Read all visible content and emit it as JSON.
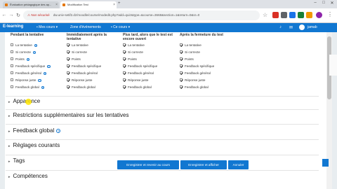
{
  "browser": {
    "tabs": [
      {
        "label": "Évaluation pédagogique des ap...",
        "active": false
      },
      {
        "label": "Modification Test",
        "active": true
      }
    ],
    "address": {
      "warning": "Non sécurisé",
      "url": "dw.univ-setif2.dz/moodle/course/modedit.php?add=quiz&type=&course=3668&section=1&return=0&sr=0"
    }
  },
  "navbar": {
    "brand": "E-learning",
    "items": [
      "Mes cours",
      "Zone d'événements",
      "Ce cours"
    ],
    "user": "jamab"
  },
  "review": {
    "columns": [
      {
        "title": "Pendant la tentative",
        "options": [
          {
            "label": "La tentative",
            "checked": false,
            "help": true
          },
          {
            "label": "Si correcte",
            "checked": false,
            "help": true
          },
          {
            "label": "Points",
            "checked": false,
            "help": true
          },
          {
            "label": "Feedback spécifique",
            "checked": false,
            "help": true
          },
          {
            "label": "Feedback général",
            "checked": false,
            "help": true
          },
          {
            "label": "Réponse juste",
            "checked": false,
            "help": true
          },
          {
            "label": "Feedback global",
            "checked": false,
            "help": true
          }
        ]
      },
      {
        "title": "Immédiatement après la tentative",
        "options": [
          {
            "label": "La tentative",
            "checked": true
          },
          {
            "label": "Si correcte",
            "checked": true
          },
          {
            "label": "Points",
            "checked": true
          },
          {
            "label": "Feedback spécifique",
            "checked": true
          },
          {
            "label": "Feedback général",
            "checked": true
          },
          {
            "label": "Réponse juste",
            "checked": true
          },
          {
            "label": "Feedback global",
            "checked": true
          }
        ]
      },
      {
        "title": "Plus tard, alors que le test est encore ouvert",
        "options": [
          {
            "label": "La tentative",
            "checked": true
          },
          {
            "label": "Si correcte",
            "checked": true
          },
          {
            "label": "Points",
            "checked": true
          },
          {
            "label": "Feedback spécifique",
            "checked": true
          },
          {
            "label": "Feedback général",
            "checked": true
          },
          {
            "label": "Réponse juste",
            "checked": true
          },
          {
            "label": "Feedback global",
            "checked": true
          }
        ]
      },
      {
        "title": "Après la fermeture du test",
        "options": [
          {
            "label": "La tentative",
            "checked": true
          },
          {
            "label": "Si correcte",
            "checked": true
          },
          {
            "label": "Points",
            "checked": true
          },
          {
            "label": "Feedback spécifique",
            "checked": true
          },
          {
            "label": "Feedback général",
            "checked": true
          },
          {
            "label": "Réponse juste",
            "checked": true
          },
          {
            "label": "Feedback global",
            "checked": true
          }
        ]
      }
    ]
  },
  "sections": {
    "apparence": "Apparence",
    "restrictions": "Restrictions supplémentaires sur les tentatives",
    "feedback": "Feedback global",
    "reglages": "Réglages courants",
    "tags": "Tags",
    "competences": "Compétences"
  },
  "buttons": {
    "save_return": "Enregistrer et revenir au cours",
    "save_display": "Enregistrer et afficher",
    "cancel": "Annuler"
  },
  "colors": {
    "brand": "#1177d1",
    "cursor_highlight": "#ffe600"
  }
}
